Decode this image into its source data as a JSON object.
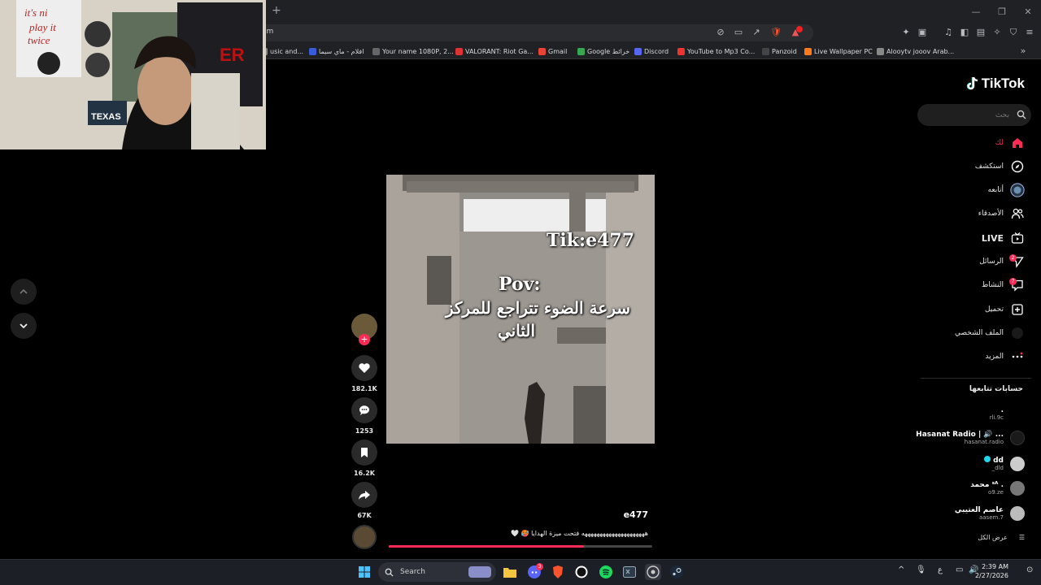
{
  "browser": {
    "url_fragment": "om",
    "bookmarks": [
      "usic and...",
      "افلام - ماي سيما",
      "Your name 1080P, 2...",
      "VALORANT: Riot Ga...",
      "Gmail",
      "Google خرائط",
      "Discord",
      "YouTube to Mp3 Co...",
      "Panzoid",
      "Live Wallpaper PC",
      "Alooytv jooov Arab..."
    ],
    "bookmark_colors": [
      "#888",
      "#3a5bd9",
      "#666",
      "#d33",
      "#ea4335",
      "#34a853",
      "#5865f2",
      "#e33",
      "#444",
      "#ff7a1a",
      "#888"
    ],
    "extension_badge_1": "",
    "extension_badge_2": ""
  },
  "tiktok": {
    "logo_text": "TikTok",
    "search_placeholder": "بحث",
    "nav": [
      {
        "label": "لك",
        "icon": "home-icon",
        "active": true
      },
      {
        "label": "استكشف",
        "icon": "compass-icon"
      },
      {
        "label": "أتابعه",
        "icon": "following-avatar-icon"
      },
      {
        "label": "الأصدقاء",
        "icon": "friends-icon"
      },
      {
        "label": "LIVE",
        "icon": "live-tv-icon",
        "bold": true
      },
      {
        "label": "الرسائل",
        "icon": "messages-icon",
        "badge": "2"
      },
      {
        "label": "النشاط",
        "icon": "activity-icon",
        "badge": "7"
      },
      {
        "label": "تحميل",
        "icon": "upload-icon"
      },
      {
        "label": "الملف الشخصي",
        "icon": "profile-avatar-icon"
      },
      {
        "label": "المزيد",
        "icon": "more-icon"
      }
    ],
    "following_title": "حسابات تتابعها",
    "following": [
      {
        "name": ".",
        "handle": "rli.9c"
      },
      {
        "name": "Hasanat Radio | 🔊 ...",
        "handle": "hasanat.radio"
      },
      {
        "name": "dd",
        "handle": "_dld",
        "verified": true
      },
      {
        "name": "محمد ˢᴬ .",
        "handle": "o9.ze"
      },
      {
        "name": "عاصم العتيبي",
        "handle": "aasem.7"
      }
    ],
    "see_all": "عرض الكل",
    "video": {
      "overlay_watermark": "Tik:e477",
      "overlay_line1": "Pov:",
      "overlay_line2": "سرعة الضوء تتراجع للمركز",
      "overlay_line3": "الثاني",
      "author": "e477",
      "caption": "هههههههههههههههههههههه فتحت ميزة الهدايا 🥵 🤍",
      "progress": 0.74
    },
    "actions": {
      "likes": "182.1K",
      "comments": "1253",
      "saves": "16.2K",
      "shares": "67K"
    }
  },
  "taskbar": {
    "search_label": "Search",
    "time": "2:39 AM",
    "date": "2/27/2026",
    "lang": "ع",
    "discord_badge": "3"
  }
}
